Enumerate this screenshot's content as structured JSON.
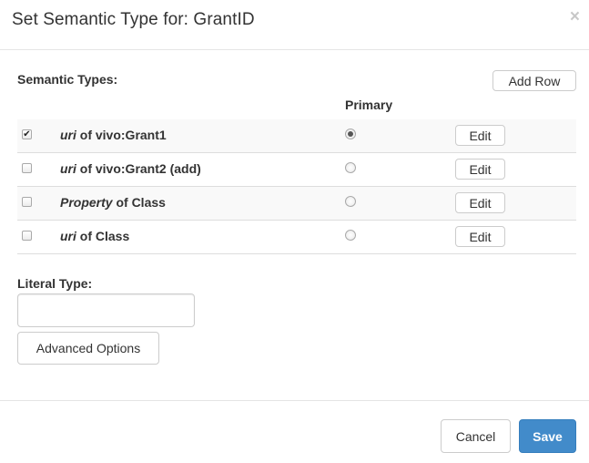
{
  "dialog": {
    "title": "Set Semantic Type for: GrantID",
    "close_glyph": "×"
  },
  "semantic_types": {
    "label": "Semantic Types:",
    "add_row_label": "Add Row",
    "primary_header": "Primary",
    "rows": [
      {
        "checked": true,
        "keyword": "uri",
        "rest": " of vivo:Grant1",
        "primary": true,
        "edit_label": "Edit"
      },
      {
        "checked": false,
        "keyword": "uri",
        "rest": " of vivo:Grant2 (add)",
        "primary": false,
        "edit_label": "Edit"
      },
      {
        "checked": false,
        "keyword": "Property",
        "rest": " of Class",
        "primary": false,
        "edit_label": "Edit"
      },
      {
        "checked": false,
        "keyword": "uri",
        "rest": " of Class",
        "primary": false,
        "edit_label": "Edit"
      }
    ]
  },
  "literal_type": {
    "label": "Literal Type:",
    "value": "",
    "placeholder": ""
  },
  "advanced_options_label": "Advanced Options",
  "footer": {
    "cancel_label": "Cancel",
    "save_label": "Save"
  },
  "colors": {
    "primary_button": "#428bca",
    "stripe": "#f9f9f9",
    "border": "#dddddd"
  }
}
